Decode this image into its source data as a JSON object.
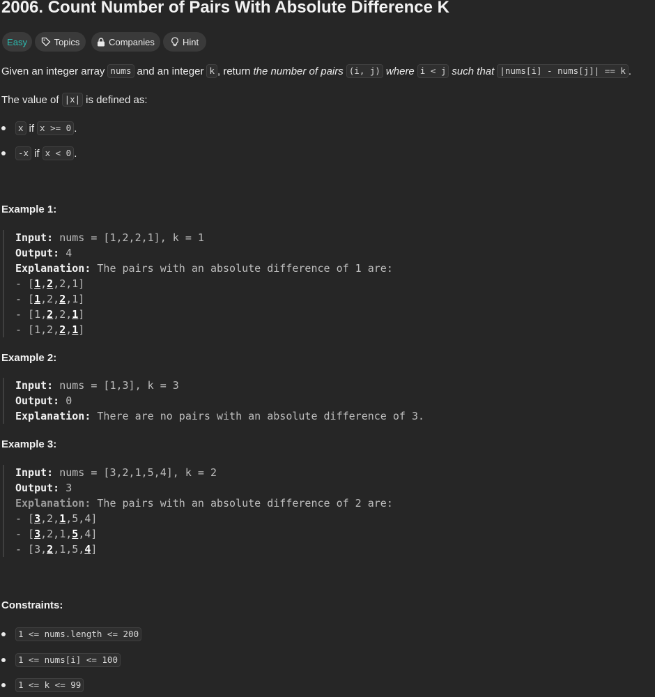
{
  "title": "2006. Count Number of Pairs With Absolute Difference K",
  "tags": {
    "difficulty": "Easy",
    "topics": "Topics",
    "companies": "Companies",
    "hint": "Hint"
  },
  "desc": {
    "p1_a": "Given an integer array",
    "p1_nums": "nums",
    "p1_b": "and an integer",
    "p1_k": "k",
    "p1_c": ", return",
    "p1_em1": "the number of pairs",
    "p1_pair": "(i, j)",
    "p1_em2": "where",
    "p1_cond": "i < j",
    "p1_em3": "such that",
    "p1_expr": "|nums[i] - nums[j]| == k",
    "p1_end": ".",
    "p2_a": "The value of",
    "p2_code": "|x|",
    "p2_b": "is defined as:",
    "b1_code1": "x",
    "b1_if": "if",
    "b1_code2": "x >= 0",
    "b1_end": ".",
    "b2_code1": "-x",
    "b2_if": "if",
    "b2_code2": "x < 0",
    "b2_end": "."
  },
  "examples": [
    {
      "heading": "Example 1:",
      "input_label": "Input:",
      "input": " nums = [1,2,2,1], k = 1",
      "output_label": "Output:",
      "output": " 4",
      "explanation_label": "Explanation:",
      "explanation": " The pairs with an absolute difference of 1 are:",
      "pairs": [
        [
          "- [",
          "1",
          ",",
          "2",
          ",2,1]"
        ],
        [
          "- [",
          "1",
          ",2,",
          "2",
          ",1]"
        ],
        [
          "- [1,",
          "2",
          ",2,",
          "1",
          "]"
        ],
        [
          "- [1,2,",
          "2",
          ",",
          "1",
          "]"
        ]
      ]
    },
    {
      "heading": "Example 2:",
      "input_label": "Input:",
      "input": " nums = [1,3], k = 3",
      "output_label": "Output:",
      "output": " 0",
      "explanation_label": "Explanation:",
      "explanation": " There are no pairs with an absolute difference of 3."
    },
    {
      "heading": "Example 3:",
      "input_label": "Input:",
      "input": " nums = [3,2,1,5,4], k = 2",
      "output_label": "Output:",
      "output": " 3",
      "explanation_label": "Explanation:",
      "explanation": " The pairs with an absolute difference of 2 are:",
      "pairs": [
        [
          "- [",
          "3",
          ",2,",
          "1",
          ",5,4]"
        ],
        [
          "- [",
          "3",
          ",2,1,",
          "5",
          ",4]"
        ],
        [
          "- [3,",
          "2",
          ",1,5,",
          "4",
          "]"
        ]
      ]
    }
  ],
  "constraints": {
    "heading": "Constraints:",
    "items": [
      "1 <= nums.length <= 200",
      "1 <= nums[i] <= 100",
      "1 <= k <= 99"
    ]
  }
}
